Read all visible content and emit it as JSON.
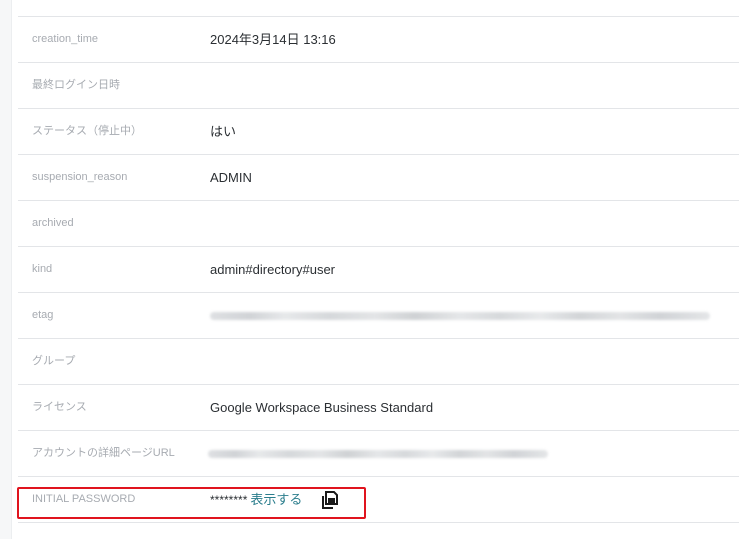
{
  "rows": [
    {
      "label": "creation_time",
      "value": "2024年3月14日 13:16"
    },
    {
      "label": "最終ログイン日時",
      "value": ""
    },
    {
      "label": "ステータス（停止中）",
      "value": "はい"
    },
    {
      "label": "suspension_reason",
      "value": "ADMIN"
    },
    {
      "label": "archived",
      "value": ""
    },
    {
      "label": "kind",
      "value": "admin#directory#user"
    },
    {
      "label": "etag",
      "value": ""
    },
    {
      "label": "グループ",
      "value": ""
    },
    {
      "label": "ライセンス",
      "value": "Google Workspace Business Standard"
    },
    {
      "label": "アカウントの詳細ページURL",
      "value": ""
    }
  ],
  "password": {
    "label": "INITIAL PASSWORD",
    "masked": "********",
    "reveal_label": "表示する",
    "copy_icon": "copy-icon"
  },
  "colors": {
    "highlight": "#e0141e",
    "link": "#2a7d8c",
    "label": "#a7abb1",
    "value": "#2b2f33"
  }
}
